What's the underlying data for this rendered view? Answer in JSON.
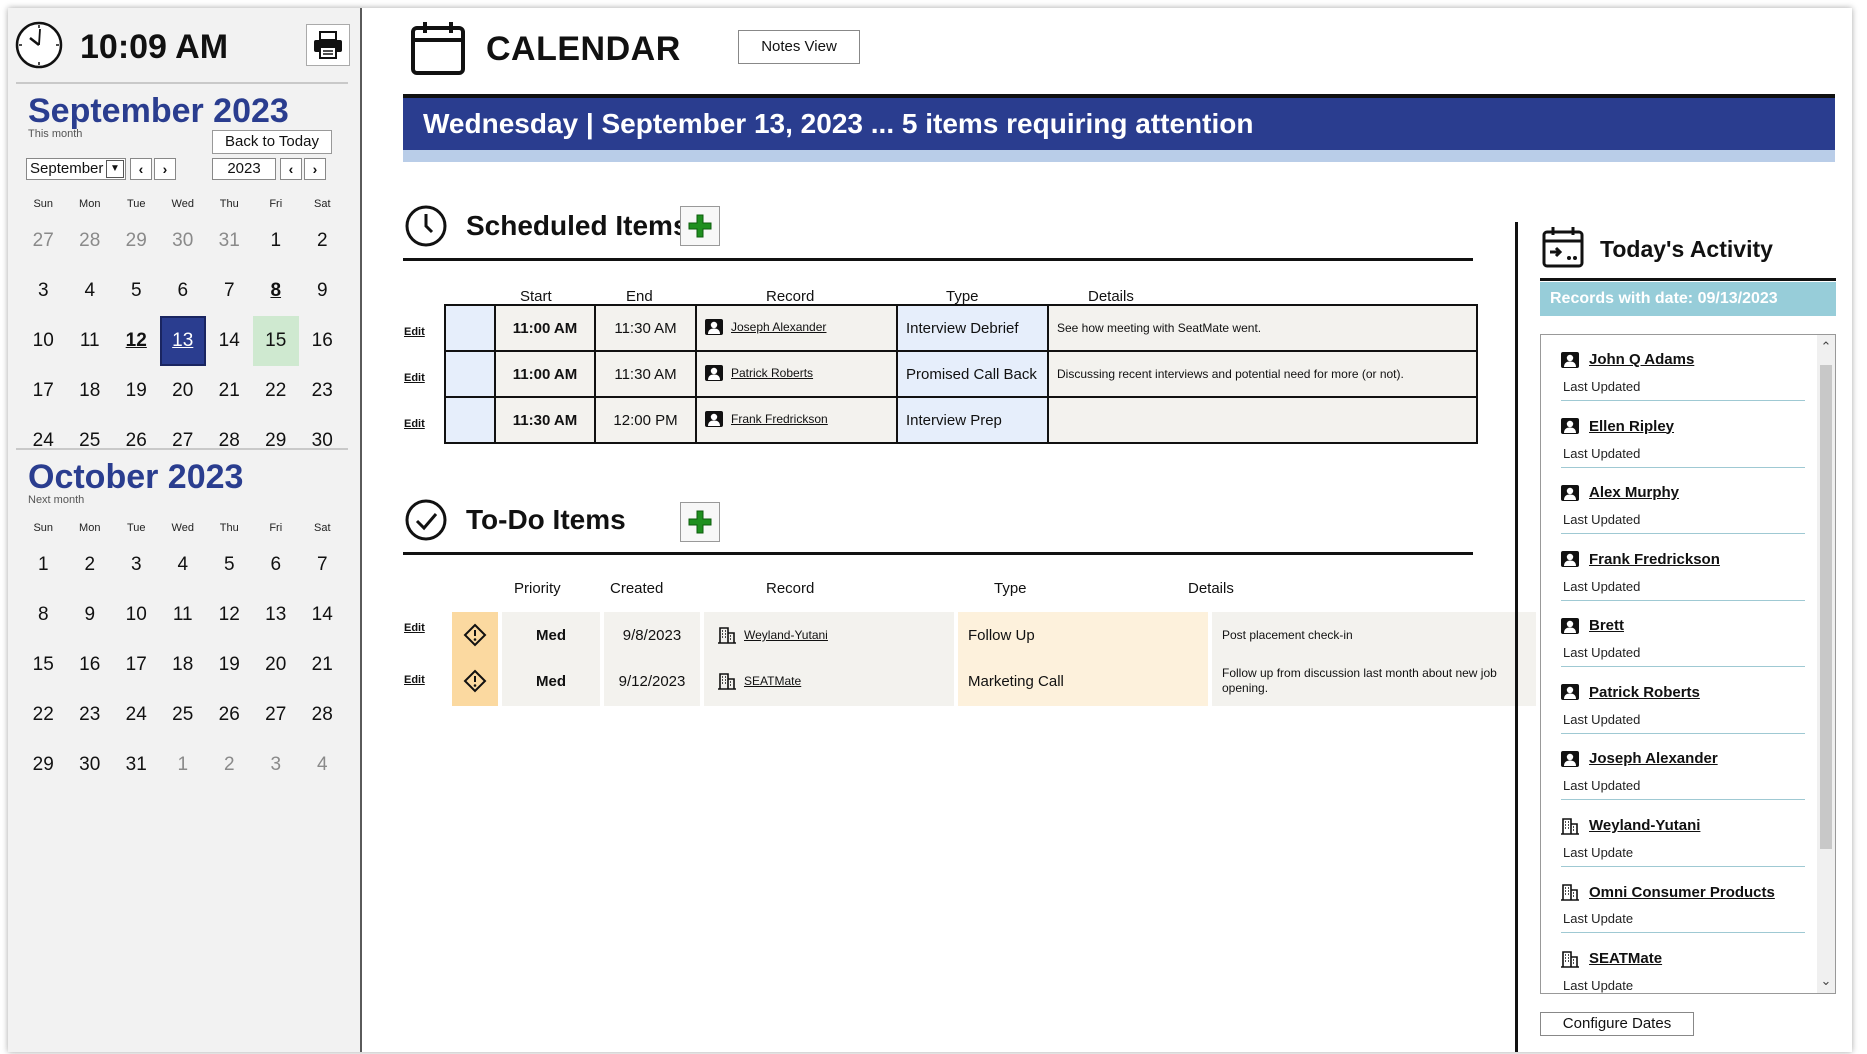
{
  "clock": {
    "time": "10:09 AM"
  },
  "september": {
    "title": "September 2023",
    "subtitle": "This month",
    "back_today": "Back to Today",
    "month_value": "September",
    "year_value": "2023",
    "dows": [
      "Sun",
      "Mon",
      "Tue",
      "Wed",
      "Thu",
      "Fri",
      "Sat"
    ],
    "days": [
      "27",
      "28",
      "29",
      "30",
      "31",
      "1",
      "2",
      "3",
      "4",
      "5",
      "6",
      "7",
      "8",
      "9",
      "10",
      "11",
      "12",
      "13",
      "14",
      "15",
      "16",
      "17",
      "18",
      "19",
      "20",
      "21",
      "22",
      "23",
      "24",
      "25",
      "26",
      "27",
      "28",
      "29",
      "30"
    ]
  },
  "october": {
    "title": "October 2023",
    "subtitle": "Next month",
    "dows": [
      "Sun",
      "Mon",
      "Tue",
      "Wed",
      "Thu",
      "Fri",
      "Sat"
    ],
    "days": [
      "1",
      "2",
      "3",
      "4",
      "5",
      "6",
      "7",
      "8",
      "9",
      "10",
      "11",
      "12",
      "13",
      "14",
      "15",
      "16",
      "17",
      "18",
      "19",
      "20",
      "21",
      "22",
      "23",
      "24",
      "25",
      "26",
      "27",
      "28",
      "29",
      "30",
      "31",
      "1",
      "2",
      "3",
      "4"
    ]
  },
  "header": {
    "title": "CALENDAR",
    "notes_view": "Notes View",
    "banner": "Wednesday | September 13, 2023 ... 5 items requiring attention"
  },
  "scheduled": {
    "title": "Scheduled Items",
    "headers": {
      "start": "Start",
      "end": "End",
      "record": "Record",
      "type": "Type",
      "details": "Details"
    },
    "edit_label": "Edit",
    "rows": [
      {
        "start": "11:00 AM",
        "end": "11:30 AM",
        "record": "Joseph Alexander",
        "type": "Interview Debrief",
        "details": "See how meeting with SeatMate went."
      },
      {
        "start": "11:00 AM",
        "end": "11:30 AM",
        "record": "Patrick Roberts",
        "type": "Promised Call Back",
        "details": "Discussing recent interviews and potential need for more (or not)."
      },
      {
        "start": "11:30 AM",
        "end": "12:00 PM",
        "record": "Frank Fredrickson",
        "type": "Interview Prep",
        "details": ""
      }
    ]
  },
  "todo": {
    "title": "To-Do Items",
    "headers": {
      "priority": "Priority",
      "created": "Created",
      "record": "Record",
      "type": "Type",
      "details": "Details"
    },
    "edit_label": "Edit",
    "rows": [
      {
        "priority": "Med",
        "created": "9/8/2023",
        "record": "Weyland-Yutani",
        "type": "Follow Up",
        "details": "Post placement check-in"
      },
      {
        "priority": "Med",
        "created": "9/12/2023",
        "record": "SEATMate",
        "type": "Marketing Call",
        "details": "Follow up from discussion last month about new job opening."
      }
    ]
  },
  "activity": {
    "title": "Today's Activity",
    "banner": "Records with date: 09/13/2023",
    "items": [
      {
        "name": "John Q Adams",
        "sub": "Last Updated",
        "kind": "person"
      },
      {
        "name": "Ellen Ripley",
        "sub": "Last Updated",
        "kind": "person"
      },
      {
        "name": "Alex Murphy",
        "sub": "Last Updated",
        "kind": "person"
      },
      {
        "name": "Frank Fredrickson",
        "sub": "Last Updated",
        "kind": "person"
      },
      {
        "name": "Brett",
        "sub": "Last Updated",
        "kind": "person"
      },
      {
        "name": "Patrick Roberts",
        "sub": "Last Updated",
        "kind": "person"
      },
      {
        "name": "Joseph Alexander",
        "sub": "Last Updated",
        "kind": "person"
      },
      {
        "name": "Weyland-Yutani",
        "sub": "Last Update",
        "kind": "company"
      },
      {
        "name": "Omni Consumer Products",
        "sub": "Last Update",
        "kind": "company"
      },
      {
        "name": "SEATMate",
        "sub": "Last Update",
        "kind": "company"
      }
    ],
    "configure": "Configure Dates"
  },
  "colors": {
    "accent": "#2a3d8f",
    "today": "#cfe9d0",
    "priority": "#fbd9a0",
    "activity_banner": "#97cdd9"
  }
}
